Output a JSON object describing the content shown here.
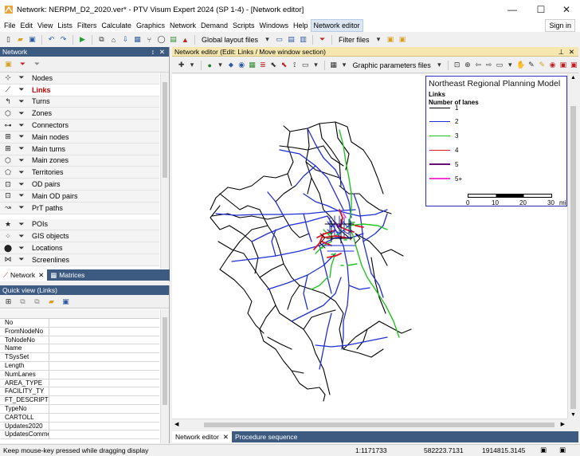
{
  "window": {
    "title": "Network: NERPM_D2_2020.ver* - PTV Visum Expert 2024 (SP 1-4) - [Network editor]",
    "controls": {
      "minimize": "—",
      "maximize": "☐",
      "close": "✕"
    }
  },
  "menu": {
    "items": [
      "File",
      "Edit",
      "View",
      "Lists",
      "Filters",
      "Calculate",
      "Graphics",
      "Network",
      "Demand",
      "Scripts",
      "Windows",
      "Help",
      "Network editor"
    ],
    "signin": "Sign in"
  },
  "toolbar": {
    "global_layout": "Global layout files",
    "filter_files": "Filter files"
  },
  "network_panel": {
    "title": "Network",
    "pin": "↕",
    "close": "✕",
    "items": [
      {
        "label": "Nodes",
        "icon": "node-icon"
      },
      {
        "label": "Links",
        "icon": "link-icon",
        "selected": true
      },
      {
        "label": "Turns",
        "icon": "turn-icon"
      },
      {
        "label": "Zones",
        "icon": "zone-icon"
      },
      {
        "label": "Connectors",
        "icon": "connector-icon"
      },
      {
        "label": "Main nodes",
        "icon": "main-node-icon"
      },
      {
        "label": "Main turns",
        "icon": "main-turn-icon"
      },
      {
        "label": "Main zones",
        "icon": "main-zone-icon"
      },
      {
        "label": "Territories",
        "icon": "territory-icon"
      },
      {
        "label": "OD pairs",
        "icon": "od-pair-icon"
      },
      {
        "label": "Main OD pairs",
        "icon": "main-od-pair-icon"
      },
      {
        "label": "PrT paths",
        "icon": "prt-path-icon"
      },
      {
        "label": "POIs",
        "icon": "poi-icon"
      },
      {
        "label": "GIS objects",
        "icon": "gis-icon"
      },
      {
        "label": "Locations",
        "icon": "location-icon"
      },
      {
        "label": "Screenlines",
        "icon": "screenline-icon"
      }
    ],
    "tabs": [
      "Network",
      "Matrices"
    ]
  },
  "quick_view": {
    "title": "Quick view (Links)",
    "fields": [
      "No",
      "FromNodeNo",
      "ToNodeNo",
      "Name",
      "TSysSet",
      "Length",
      "NumLanes",
      "AREA_TYPE",
      "FACILITY_TY",
      "FT_DESCRIPTIO",
      "TypeNo",
      "CARTOLL",
      "Updates2020",
      "UpdatesComme"
    ]
  },
  "editor": {
    "header": "Network editor (Edit: Links / Move window section)",
    "graphic_params": "Graphic parameters files",
    "tabs": [
      "Network editor",
      "Procedure sequence"
    ]
  },
  "legend": {
    "title": "Northeast Regional Planning Model",
    "layer": "Links",
    "attribute": "Number of lanes",
    "entries": [
      {
        "label": "1",
        "color": "#000000",
        "width": 1
      },
      {
        "label": "2",
        "color": "#1f2fd6",
        "width": 1.2
      },
      {
        "label": "3",
        "color": "#22c422",
        "width": 1.2
      },
      {
        "label": "4",
        "color": "#e0141e",
        "width": 1.6
      },
      {
        "label": "5",
        "color": "#6a0c7a",
        "width": 2.4
      },
      {
        "label": "5+",
        "color": "#ef3dd6",
        "width": 2.4
      }
    ],
    "scale": {
      "ticks": [
        "0",
        "10",
        "20",
        "30"
      ],
      "unit": "mi"
    }
  },
  "status": {
    "message": "Keep mouse-key pressed while dragging display",
    "scale": "1:1171733",
    "x": "582223.7131",
    "y": "1914815.3145"
  }
}
